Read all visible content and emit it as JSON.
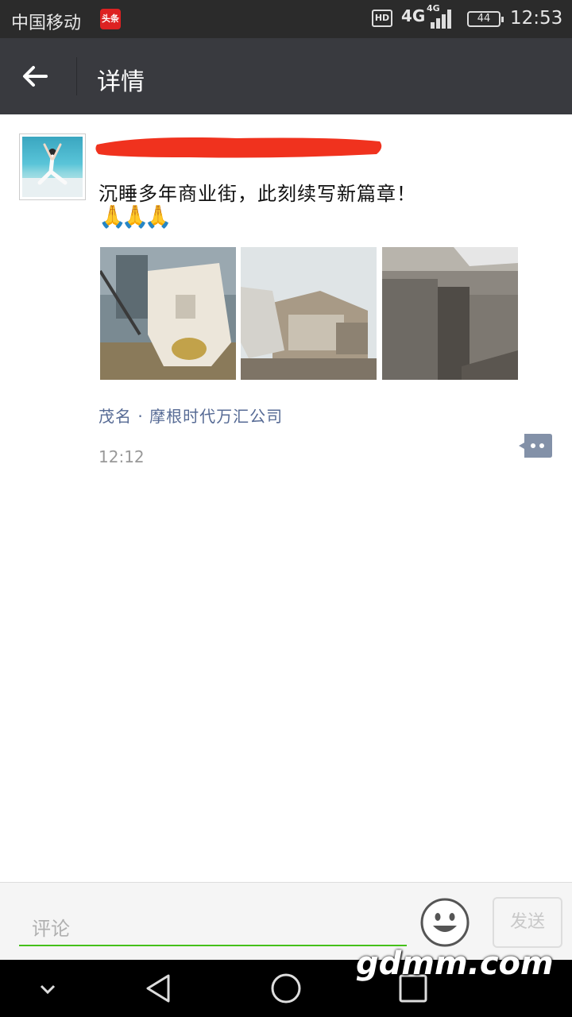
{
  "status_bar": {
    "carrier": "中国移动",
    "app_badge": "头条",
    "hd": "HD",
    "network": "4G",
    "signal_network": "4G",
    "battery": "44",
    "time": "12:53"
  },
  "header": {
    "title": "详情",
    "back_icon": "back-arrow-icon"
  },
  "post": {
    "content": "沉睡多年商业街，此刻续写新篇章！",
    "emoji": "🙏🙏🙏",
    "location": "茂名 · 摩根时代万汇公司",
    "time": "12:12"
  },
  "comment_bar": {
    "placeholder": "评论",
    "send_label": "发送"
  },
  "watermark": "gdmm.com",
  "colors": {
    "title_bar": "#393a3f",
    "status_bar": "#2b2b2b",
    "link": "#576b95",
    "accent_green": "#45c01a",
    "redaction": "#f0321e"
  }
}
